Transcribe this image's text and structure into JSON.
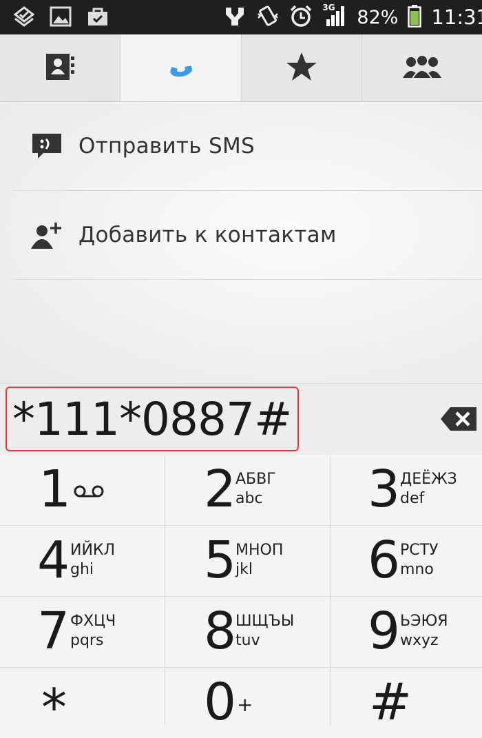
{
  "status_bar": {
    "network": "3G",
    "battery_percent": "82%",
    "time": "11:31"
  },
  "tabs": [
    {
      "icon": "contacts-icon",
      "active": false
    },
    {
      "icon": "phone-icon",
      "active": true
    },
    {
      "icon": "star-icon",
      "active": false
    },
    {
      "icon": "groups-icon",
      "active": false
    }
  ],
  "menu": {
    "send_sms": "Отправить SMS",
    "add_contact": "Добавить к контактам"
  },
  "dialer": {
    "number": "*111*0887#",
    "highlight_color": "#e53935"
  },
  "keys": [
    {
      "digit": "1",
      "cyr": "",
      "lat": "",
      "extra": "voicemail-icon"
    },
    {
      "digit": "2",
      "cyr": "АБВГ",
      "lat": "abc"
    },
    {
      "digit": "3",
      "cyr": "ДЕЁЖЗ",
      "lat": "def"
    },
    {
      "digit": "4",
      "cyr": "ИЙКЛ",
      "lat": "ghi"
    },
    {
      "digit": "5",
      "cyr": "МНОП",
      "lat": "jkl"
    },
    {
      "digit": "6",
      "cyr": "РСТУ",
      "lat": "mno"
    },
    {
      "digit": "7",
      "cyr": "ФХЦЧ",
      "lat": "pqrs"
    },
    {
      "digit": "8",
      "cyr": "ШЩЪЫ",
      "lat": "tuv"
    },
    {
      "digit": "9",
      "cyr": "ЬЭЮЯ",
      "lat": "wxyz"
    },
    {
      "digit": "*",
      "cyr": "",
      "lat": ""
    },
    {
      "digit": "0",
      "cyr": "+",
      "lat": ""
    },
    {
      "digit": "#",
      "cyr": "",
      "lat": ""
    }
  ]
}
